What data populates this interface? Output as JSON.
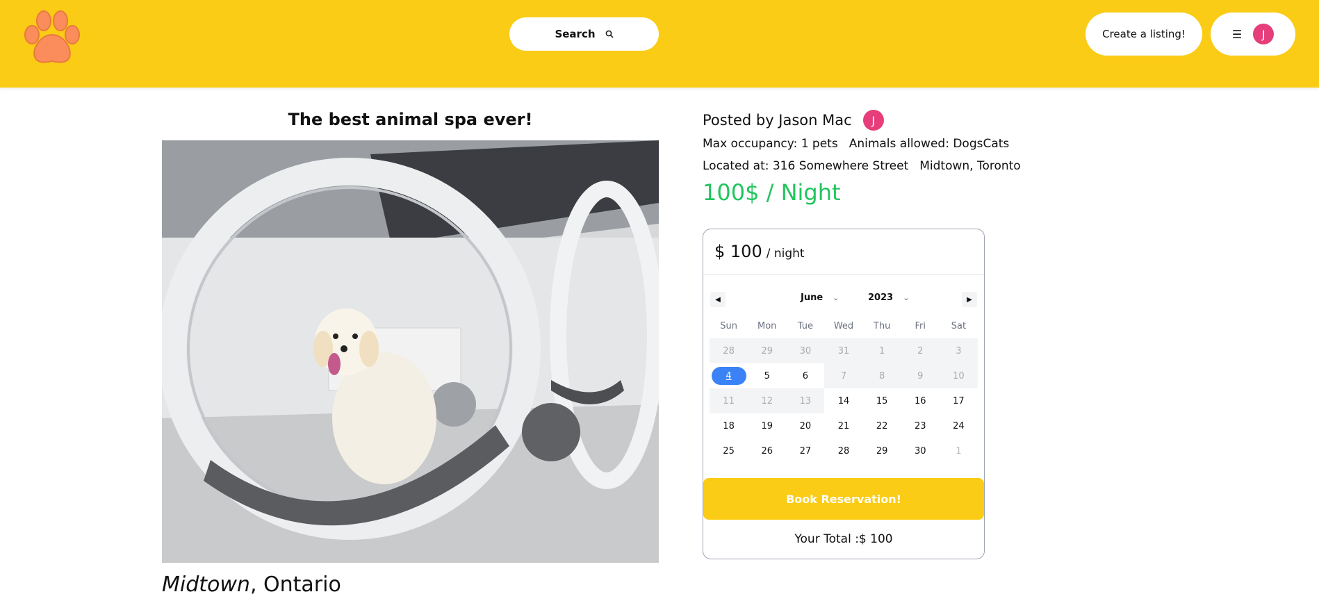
{
  "header": {
    "search_label": "Search",
    "create_listing_label": "Create a listing!",
    "avatar_initial": "J",
    "colors": {
      "bar": "#facc15",
      "avatar": "#e63e7a"
    }
  },
  "listing": {
    "title": "The best animal spa ever!",
    "suburb": "Midtown",
    "province": "Ontario",
    "posted_by_label": "Posted by Jason Mac",
    "host_initial": "J",
    "max_occupancy": "Max occupancy: 1 pets",
    "animals_allowed": "Animals allowed: DogsCats",
    "located_at": "Located at: 316 Somewhere Street",
    "area": "Midtown, Toronto",
    "price_per_night": "100$ / Night",
    "price_color": "#22c55e"
  },
  "booking": {
    "amount": "$ 100",
    "unit": "/ night",
    "calendar": {
      "month": "June",
      "year": "2023",
      "weekdays": [
        "Sun",
        "Mon",
        "Tue",
        "Wed",
        "Thu",
        "Fri",
        "Sat"
      ],
      "days": [
        {
          "label": "28",
          "state": "disabled"
        },
        {
          "label": "29",
          "state": "disabled"
        },
        {
          "label": "30",
          "state": "disabled"
        },
        {
          "label": "31",
          "state": "disabled"
        },
        {
          "label": "1",
          "state": "disabled"
        },
        {
          "label": "2",
          "state": "disabled"
        },
        {
          "label": "3",
          "state": "disabled"
        },
        {
          "label": "4",
          "state": "selected"
        },
        {
          "label": "5",
          "state": "available"
        },
        {
          "label": "6",
          "state": "available"
        },
        {
          "label": "7",
          "state": "disabled"
        },
        {
          "label": "8",
          "state": "disabled"
        },
        {
          "label": "9",
          "state": "disabled"
        },
        {
          "label": "10",
          "state": "disabled"
        },
        {
          "label": "11",
          "state": "disabled"
        },
        {
          "label": "12",
          "state": "disabled"
        },
        {
          "label": "13",
          "state": "disabled"
        },
        {
          "label": "14",
          "state": "available"
        },
        {
          "label": "15",
          "state": "available"
        },
        {
          "label": "16",
          "state": "available"
        },
        {
          "label": "17",
          "state": "available"
        },
        {
          "label": "18",
          "state": "available"
        },
        {
          "label": "19",
          "state": "available"
        },
        {
          "label": "20",
          "state": "available"
        },
        {
          "label": "21",
          "state": "available"
        },
        {
          "label": "22",
          "state": "available"
        },
        {
          "label": "23",
          "state": "available"
        },
        {
          "label": "24",
          "state": "available"
        },
        {
          "label": "25",
          "state": "available"
        },
        {
          "label": "26",
          "state": "available"
        },
        {
          "label": "27",
          "state": "available"
        },
        {
          "label": "28",
          "state": "available"
        },
        {
          "label": "29",
          "state": "available"
        },
        {
          "label": "30",
          "state": "available"
        },
        {
          "label": "1",
          "state": "outside"
        }
      ]
    },
    "book_label": "Book Reservation!",
    "total_label": "Your Total :$ 100"
  }
}
